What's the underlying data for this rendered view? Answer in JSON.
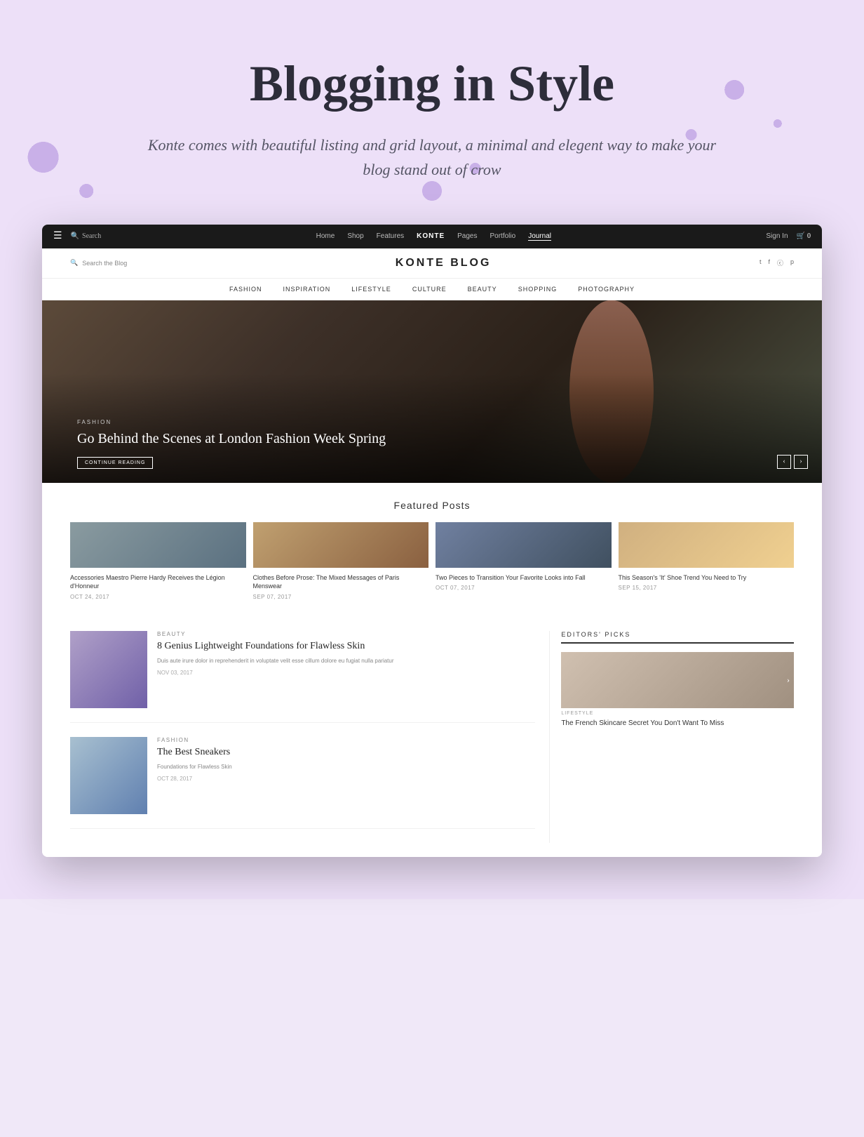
{
  "hero": {
    "title": "Blogging in Style",
    "subtitle": "Konte comes with beautiful listing and grid layout, a minimal and elegent way to make your blog stand out of crow"
  },
  "nav": {
    "links": [
      "Home",
      "Shop",
      "Features",
      "KONTE",
      "Pages",
      "Portfolio",
      "Journal"
    ],
    "active": "KONTE",
    "underlined": "Journal",
    "search_label": "Search",
    "signin_label": "Sign In",
    "cart_label": "0"
  },
  "blog_header": {
    "search_placeholder": "Search the Blog",
    "title": "KONTE BLOG",
    "social_links": [
      "t",
      "f",
      "i",
      "p"
    ]
  },
  "category_nav": {
    "items": [
      "FASHION",
      "INSPIRATION",
      "LIFESTYLE",
      "CULTURE",
      "BEAUTY",
      "SHOPPING",
      "PHOTOGRAPHY"
    ]
  },
  "hero_post": {
    "tag": "FASHION",
    "title": "Go Behind the Scenes at London Fashion Week Spring",
    "cta": "CONTINUE READING"
  },
  "featured": {
    "section_title": "Featured Posts",
    "posts": [
      {
        "title": "Accessories Maestro Pierre Hardy Receives the Légion d'Honneur",
        "date": "OCT 24, 2017"
      },
      {
        "title": "Clothes Before Prose: The Mixed Messages of Paris Menswear",
        "date": "SEP 07, 2017"
      },
      {
        "title": "Two Pieces to Transition Your Favorite Looks into Fall",
        "date": "OCT 07, 2017"
      },
      {
        "title": "This Season's 'It' Shoe Trend You Need to Try",
        "date": "SEP 15, 2017"
      }
    ]
  },
  "main_posts": [
    {
      "tag": "BEAUTY",
      "title": "8 Genius Lightweight Foundations for Flawless Skin",
      "excerpt": "Duis aute irure dolor in reprehenderit in voluptate velit esse cillum dolore eu fugiat nulla pariatur",
      "date": "NOV 03, 2017"
    },
    {
      "tag": "FASHION",
      "title": "The Best Sneakers",
      "excerpt": "Foundations for Flawless Skin",
      "date": "OCT 28, 2017"
    }
  ],
  "sidebar": {
    "title": "EDITORS' PICKS",
    "items": [
      {
        "tag": "LIFESTYLE",
        "title": "The French Skincare Secret You Don't Want To Miss"
      }
    ]
  }
}
